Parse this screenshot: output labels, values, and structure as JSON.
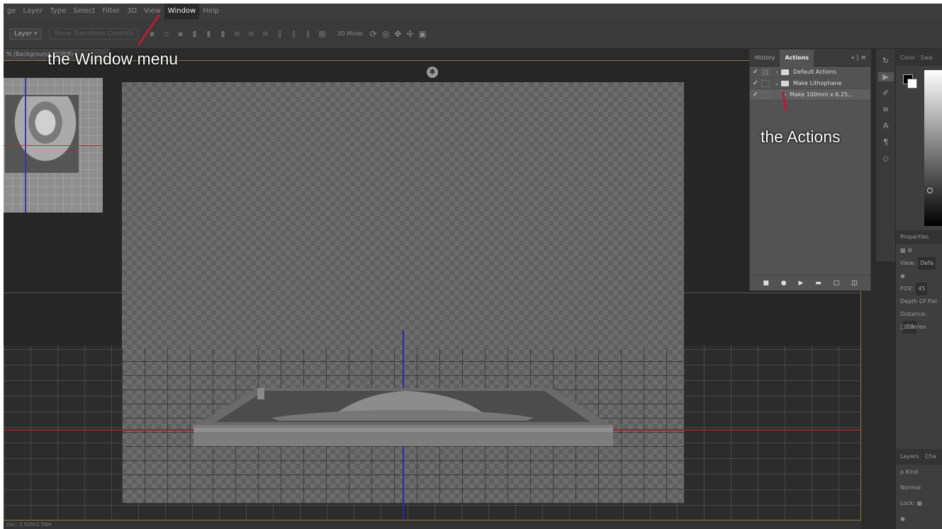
{
  "menubar": {
    "items": [
      "ge",
      "Layer",
      "Type",
      "Select",
      "Filter",
      "3D",
      "View",
      "Window",
      "Help"
    ],
    "active": "Window"
  },
  "options": {
    "layer_dropdown": "Layer",
    "show_transform": "Show Transform Controls",
    "mode_label": "3D Mode:"
  },
  "document": {
    "tab_title": "% (Background, RGB/8) *",
    "status": "Doc: 1.92M/2.56M"
  },
  "actions_panel": {
    "tabs": [
      "History",
      "Actions"
    ],
    "active_tab": "Actions",
    "rows": [
      {
        "label": "Default Actions",
        "checked": true,
        "expanded": false
      },
      {
        "label": "Make Lithophane",
        "checked": true,
        "expanded": true
      },
      {
        "label": "Make 100mm x 6.25...",
        "checked": true,
        "child": true
      }
    ]
  },
  "right_panels": {
    "color_tabs": [
      "Color",
      "Swa"
    ],
    "properties_title": "Properties",
    "view_label": "View:",
    "view_value": "Defa",
    "fov_label": "FOV:",
    "fov_value": "45",
    "dof_title": "Depth Of Fiel",
    "distance_label": "Distance:",
    "distance_value": "0.5",
    "stereo_label": "Stereo",
    "layers_tabs": [
      "Layers",
      "Cha"
    ],
    "kind_label": "ρ Kind",
    "blend_mode": "Normal",
    "lock_label": "Lock:"
  },
  "annotations": {
    "window_menu": "the Window menu",
    "actions": "the Actions"
  },
  "colors": {
    "annotation_line": "#b81c34",
    "accent_border": "#8a7a3a"
  }
}
